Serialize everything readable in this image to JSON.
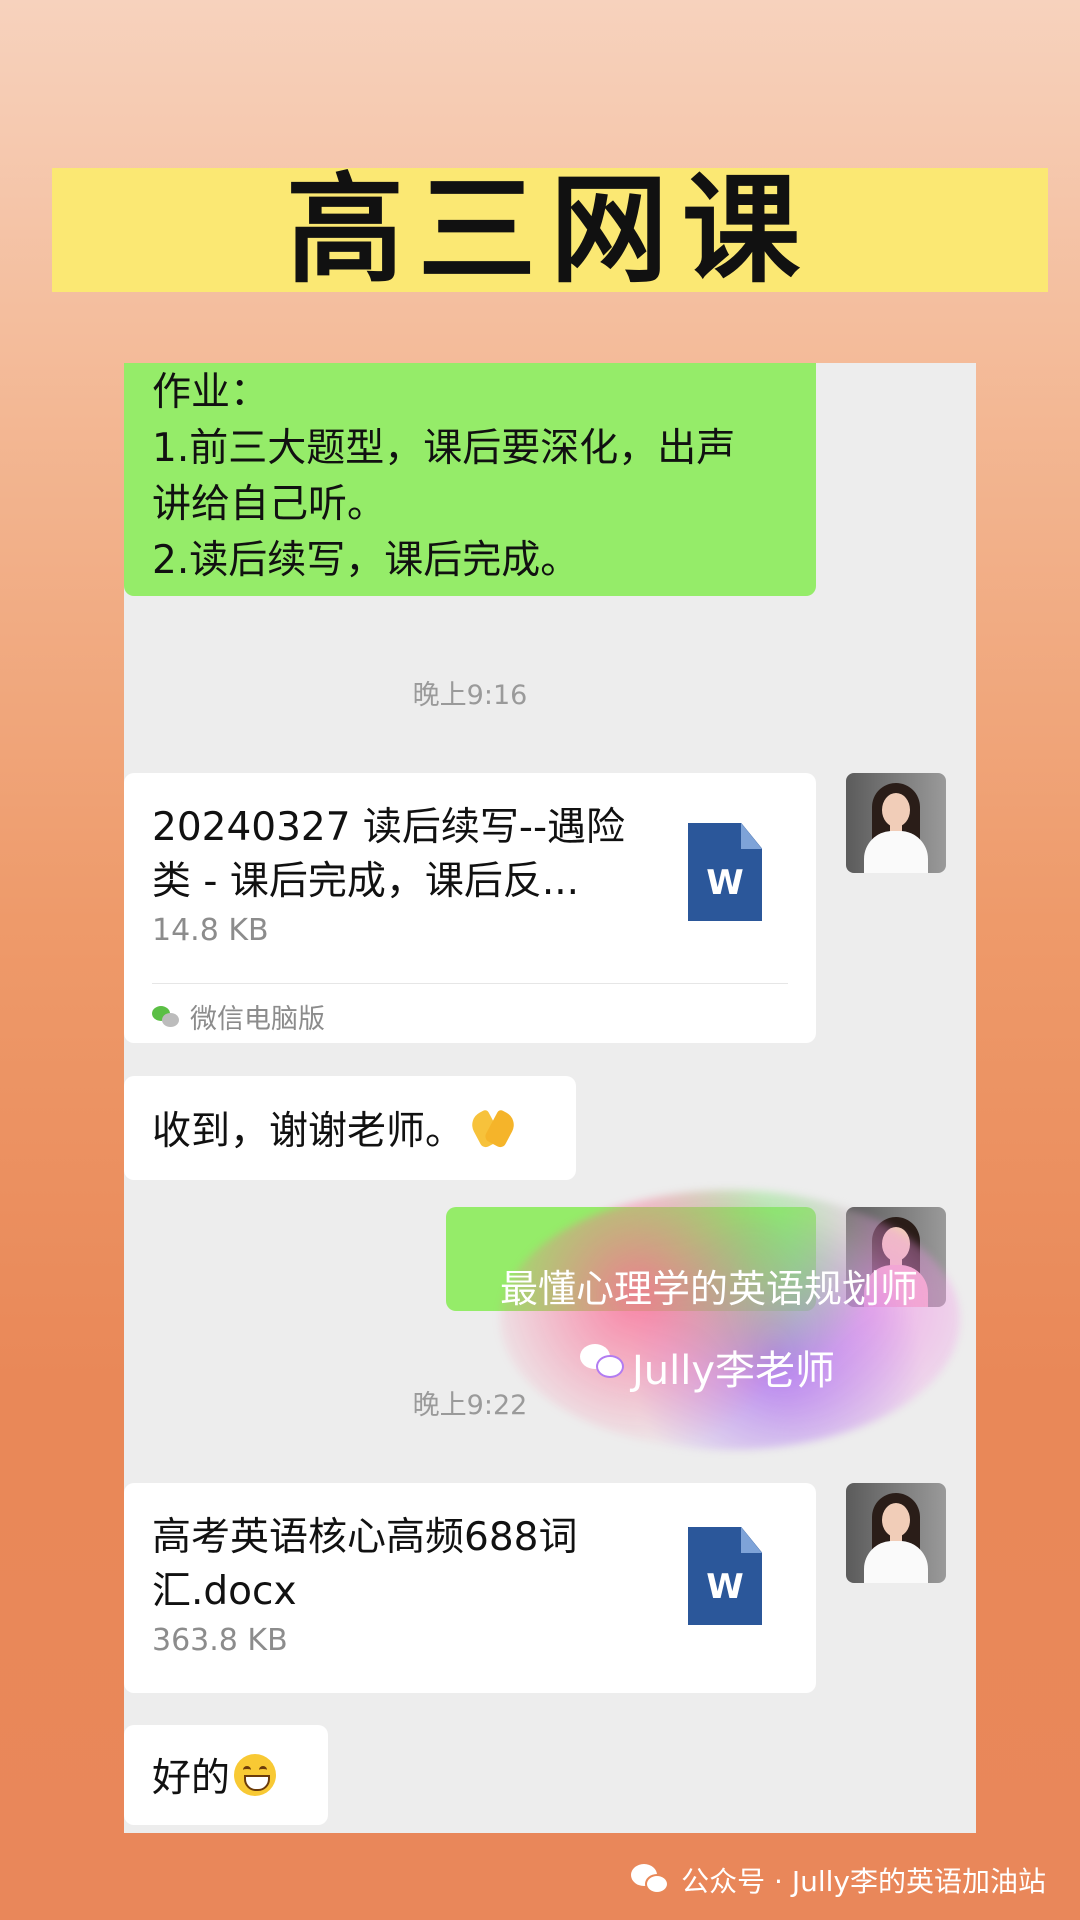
{
  "banner": {
    "title": "高三网课"
  },
  "chat": {
    "homework_message": {
      "lines": [
        "作业：",
        "1.前三大题型，课后要深化，出声",
        "讲给自己听。",
        "2.读后续写，课后完成。"
      ]
    },
    "timestamp_1": "晚上9:16",
    "file_1": {
      "name_line_1": "20240327 读后续写--遇险",
      "name_line_2": "类 - 课后完成，课后反...",
      "size": "14.8 KB",
      "icon_letter": "W",
      "source": "微信电脑版"
    },
    "reply_1": "收到，谢谢老师。",
    "timestamp_2": "晚上9:22",
    "file_2": {
      "name_line_1": "高考英语核心高频688词",
      "name_line_2": "汇.docx",
      "size": "363.8 KB",
      "icon_letter": "W"
    },
    "reply_2": "好的"
  },
  "watermark": {
    "line_1": "最懂心理学的英语规划师",
    "line_2": "Jully李老师"
  },
  "footer": {
    "text": "公众号 · Jully李的英语加油站"
  },
  "colors": {
    "banner": "#fbe873",
    "sent_bubble": "#95ec69",
    "chat_background": "#ededed",
    "word_icon": "#2b579a"
  }
}
